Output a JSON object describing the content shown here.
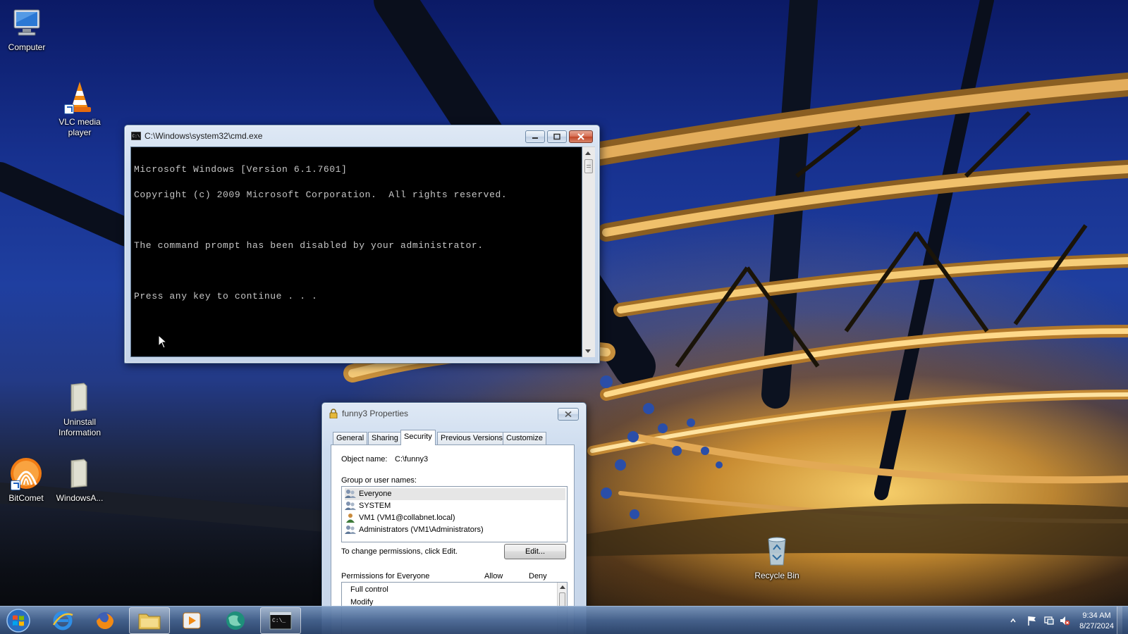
{
  "desktop": {
    "icons": [
      {
        "label": "Computer"
      },
      {
        "label": "VLC media player"
      },
      {
        "label": "Uninstall Information"
      },
      {
        "label": "BitComet"
      },
      {
        "label": "WindowsA..."
      },
      {
        "label": "Recycle Bin"
      }
    ]
  },
  "cmd_window": {
    "title": "C:\\Windows\\system32\\cmd.exe",
    "lines": [
      "Microsoft Windows [Version 6.1.7601]",
      "Copyright (c) 2009 Microsoft Corporation.  All rights reserved.",
      "",
      "The command prompt has been disabled by your administrator.",
      "",
      "Press any key to continue . . ."
    ]
  },
  "properties_window": {
    "title": "funny3 Properties",
    "tabs": [
      {
        "label": "General"
      },
      {
        "label": "Sharing"
      },
      {
        "label": "Security"
      },
      {
        "label": "Previous Versions"
      },
      {
        "label": "Customize"
      }
    ],
    "active_tab": "Security",
    "object_name_label": "Object name:",
    "object_name_value": "C:\\funny3",
    "group_label": "Group or user names:",
    "groups": [
      {
        "name": "Everyone",
        "selected": true
      },
      {
        "name": "SYSTEM"
      },
      {
        "name": "VM1 (VM1@collabnet.local)"
      },
      {
        "name": "Administrators (VM1\\Administrators)"
      }
    ],
    "change_hint": "To change permissions, click Edit.",
    "edit_button": "Edit...",
    "permissions_label": "Permissions for Everyone",
    "allow_header": "Allow",
    "deny_header": "Deny",
    "permissions": [
      {
        "name": "Full control"
      },
      {
        "name": "Modify"
      }
    ]
  },
  "taskbar": {
    "items": [
      {
        "icon": "internet-explorer-icon"
      },
      {
        "icon": "firefox-icon"
      },
      {
        "icon": "windows-explorer-icon"
      },
      {
        "icon": "media-player-icon"
      },
      {
        "icon": "globe-app-icon"
      },
      {
        "icon": "cmd-icon"
      }
    ],
    "clock": {
      "time": "9:34 AM",
      "date": "8/27/2024"
    }
  },
  "colors": {
    "console_bg": "#000000",
    "console_fg": "#c6c6c6",
    "close_button": "#c24526"
  }
}
